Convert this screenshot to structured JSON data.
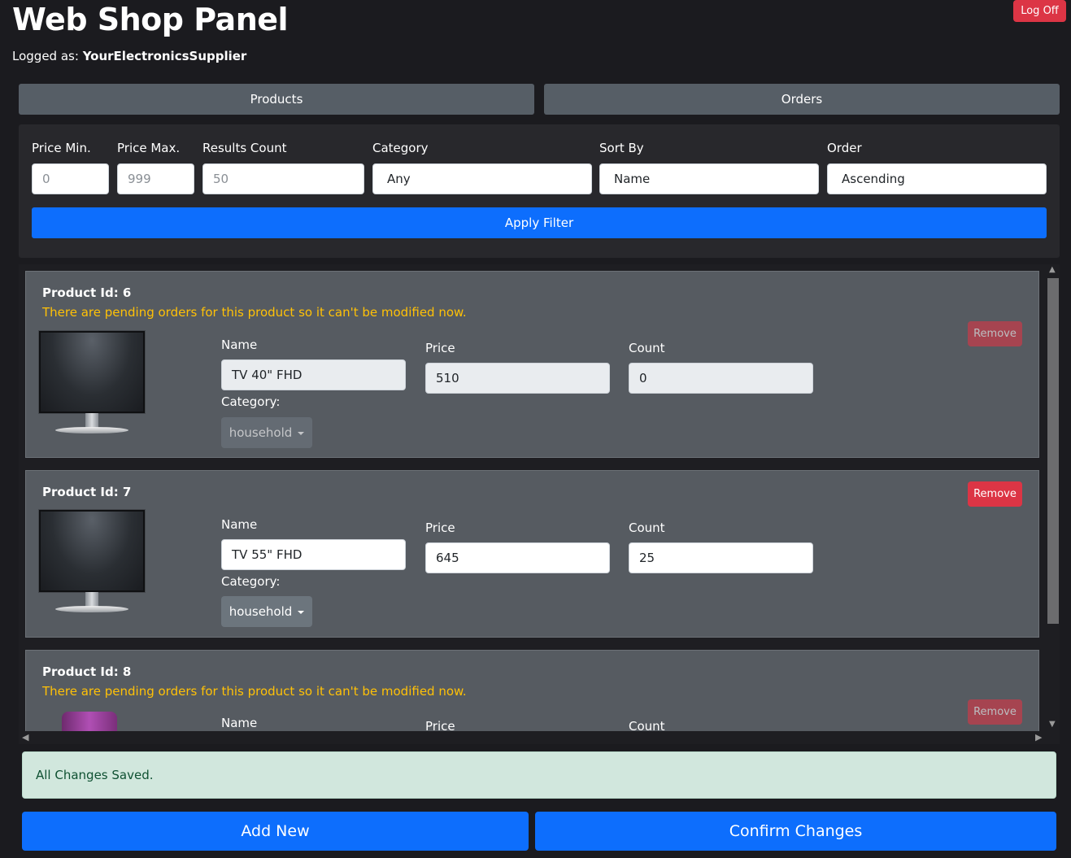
{
  "header": {
    "title": "Web Shop Panel",
    "logged_prefix": "Logged as:",
    "username": "YourElectronicsSupplier",
    "logoff_label": "Log Off"
  },
  "tabs": {
    "products": "Products",
    "orders": "Orders"
  },
  "filter": {
    "price_min_label": "Price Min.",
    "price_min_placeholder": "0",
    "price_max_label": "Price Max.",
    "price_max_placeholder": "999",
    "results_count_label": "Results Count",
    "results_count_placeholder": "50",
    "category_label": "Category",
    "category_value": "Any",
    "sort_by_label": "Sort By",
    "sort_by_value": "Name",
    "order_label": "Order",
    "order_value": "Ascending",
    "apply_label": "Apply Filter"
  },
  "products": [
    {
      "id_label": "Product Id: 6",
      "pending_msg": "There are pending orders for this product so it can't be modified now.",
      "name_label": "Name",
      "name": "TV 40\" FHD",
      "price_label": "Price",
      "price": "510",
      "count_label": "Count",
      "count": "0",
      "category_label": "Category:",
      "category": "household",
      "remove_label": "Remove"
    },
    {
      "id_label": "Product Id: 7",
      "name_label": "Name",
      "name": "TV 55\" FHD",
      "price_label": "Price",
      "price": "645",
      "count_label": "Count",
      "count": "25",
      "category_label": "Category:",
      "category": "household",
      "remove_label": "Remove"
    },
    {
      "id_label": "Product Id: 8",
      "pending_msg": "There are pending orders for this product so it can't be modified now.",
      "name_label": "Name",
      "price_label": "Price",
      "count_label": "Count",
      "remove_label": "Remove"
    }
  ],
  "status_message": "All Changes Saved.",
  "actions": {
    "add_new": "Add New",
    "confirm": "Confirm Changes"
  },
  "colors": {
    "background": "#1b1b1f",
    "primary": "#0d6efd",
    "danger": "#dc3545",
    "warning_text": "#ffc107",
    "success_bg": "#d1e7dd"
  }
}
